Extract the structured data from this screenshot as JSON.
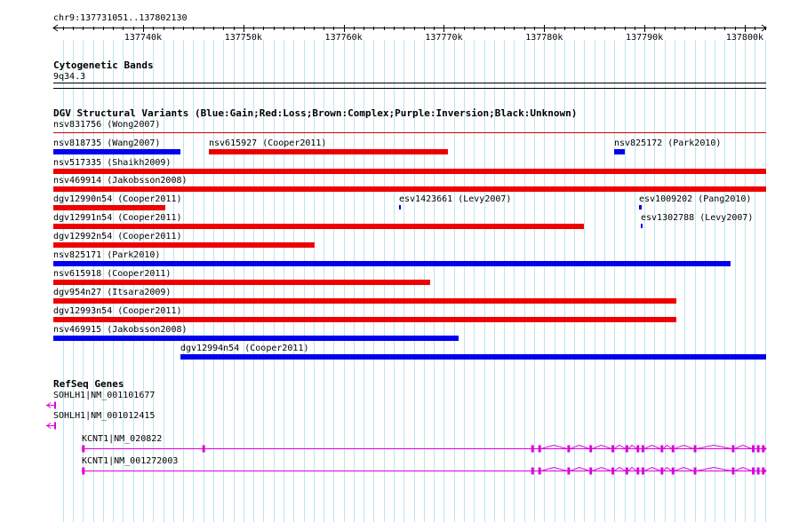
{
  "colors": {
    "grid": "#bfe3ef",
    "gain": "#0000ee",
    "loss": "#ee0000",
    "gene": "#dd00dd",
    "separator": "#cc0000"
  },
  "location": "chr9:137731051..137802130",
  "ruler": {
    "start": 137731051,
    "end": 137802130,
    "ticks": [
      {
        "value": 137740000,
        "label": "137740k"
      },
      {
        "value": 137750000,
        "label": "137750k"
      },
      {
        "value": 137760000,
        "label": "137760k"
      },
      {
        "value": 137770000,
        "label": "137770k"
      },
      {
        "value": 137780000,
        "label": "137780k"
      },
      {
        "value": 137790000,
        "label": "137790k"
      },
      {
        "value": 137800000,
        "label": "137800k"
      }
    ]
  },
  "cytoband": {
    "title": "Cytogenetic Bands",
    "band": "9q34.3"
  },
  "dgv": {
    "title": "DGV Structural Variants (Blue:Gain;Red:Loss;Brown:Complex;Purple:Inversion;Black:Unknown)",
    "first_label": "nsv831756 (Wong2007)",
    "features": [
      {
        "label": "nsv818735 (Wang2007)",
        "type": "gain",
        "start": 137731051,
        "end": 137743700
      },
      {
        "label": "nsv615927 (Cooper2011)",
        "type": "loss",
        "start": 137746600,
        "end": 137770400
      },
      {
        "label": "nsv825172 (Park2010)",
        "type": "gain",
        "start": 137787000,
        "end": 137788000
      },
      {
        "label": "nsv517335 (Shaikh2009)",
        "type": "loss",
        "start": 137731051,
        "end": 137802130
      },
      {
        "label": "nsv469914 (Jakobsson2008)",
        "type": "loss",
        "start": 137731051,
        "end": 137802130
      },
      {
        "label": "dgv12990n54 (Cooper2011)",
        "type": "loss",
        "start": 137731051,
        "end": 137742200
      },
      {
        "label": "esv1423661 (Levy2007)",
        "type": "gain",
        "start": 137765500,
        "end": 137765700
      },
      {
        "label": "esv1009202 (Pang2010)",
        "type": "gain",
        "start": 137789500,
        "end": 137789700
      },
      {
        "label": "dgv12991n54 (Cooper2011)",
        "type": "loss",
        "start": 137731051,
        "end": 137784000
      },
      {
        "label": "esv1302788 (Levy2007)",
        "type": "gain",
        "start": 137789600,
        "end": 137789800
      },
      {
        "label": "dgv12992n54 (Cooper2011)",
        "type": "loss",
        "start": 137731051,
        "end": 137757100
      },
      {
        "label": "nsv825171 (Park2010)",
        "type": "gain",
        "start": 137731051,
        "end": 137798600
      },
      {
        "label": "nsv615918 (Cooper2011)",
        "type": "loss",
        "start": 137731051,
        "end": 137768600
      },
      {
        "label": "dgv954n27 (Itsara2009)",
        "type": "loss",
        "start": 137731051,
        "end": 137793200
      },
      {
        "label": "dgv12993n54 (Cooper2011)",
        "type": "loss",
        "start": 137731051,
        "end": 137793200
      },
      {
        "label": "nsv469915 (Jakobsson2008)",
        "type": "gain",
        "start": 137731051,
        "end": 137771500
      },
      {
        "label": "dgv12994n54 (Cooper2011)",
        "type": "gain",
        "start": 137743700,
        "end": 137802130
      }
    ]
  },
  "refseq": {
    "title": "RefSeq Genes",
    "genes": [
      {
        "label": "SOHLH1|NM_001101677",
        "strand": "-",
        "start": 137731051,
        "end": 137731300,
        "exons": []
      },
      {
        "label": "SOHLH1|NM_001012415",
        "strand": "-",
        "start": 137731051,
        "end": 137731300,
        "exons": []
      },
      {
        "label": "KCNT1|NM_020822",
        "strand": "+",
        "start": 137733900,
        "end": 137802130,
        "exons": [
          137734000,
          137746000,
          137778800,
          137779500,
          137782400,
          137784600,
          137786800,
          137788200,
          137789300,
          137789800,
          137791700,
          137792800,
          137795000,
          137798800,
          137800800,
          137801300,
          137801800
        ]
      },
      {
        "label": "KCNT1|NM_001272003",
        "strand": "+",
        "start": 137733900,
        "end": 137802130,
        "exons": [
          137734000,
          137778800,
          137779500,
          137782400,
          137784600,
          137786800,
          137788200,
          137789300,
          137789800,
          137791700,
          137792800,
          137795000,
          137798800,
          137800800,
          137801300,
          137801800
        ]
      }
    ]
  }
}
